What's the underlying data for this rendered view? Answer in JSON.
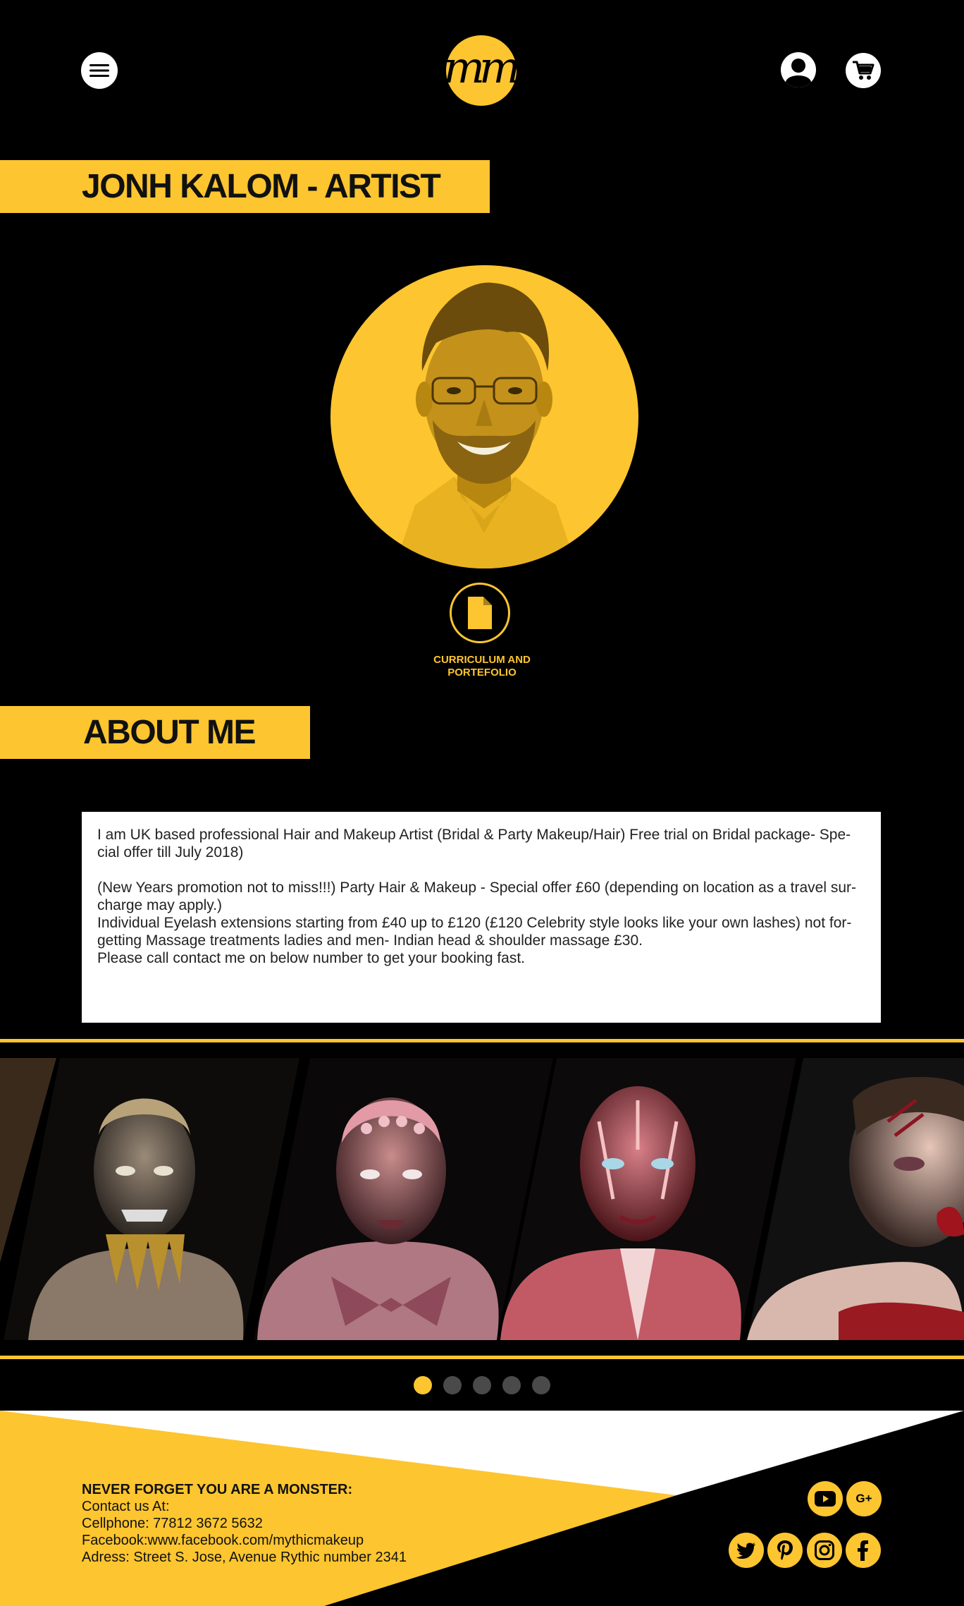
{
  "header": {
    "menu_icon": "hamburger-menu-icon",
    "logo_text": "mm",
    "account_icon": "user-account-icon",
    "cart_icon": "shopping-cart-icon"
  },
  "artist": {
    "title": "JONH KALOM - ARTIST",
    "photo": "artist-portrait",
    "cv_icon": "document-icon",
    "cv_label_line1": "CURRICULUM AND",
    "cv_label_line2": "PORTEFOLIO"
  },
  "about": {
    "title": "ABOUT ME",
    "paragraph1_line1": "I am UK based professional Hair and Makeup Artist (Bridal & Party Makeup/Hair) Free trial on Bridal package- Spe-",
    "paragraph1_line2": "cial offer till July 2018)",
    "paragraph2_line1": "(New Years promotion not to miss!!!) Party Hair & Makeup - Special offer £60 (depending on location as a travel sur-",
    "paragraph2_line2": "charge may apply.)",
    "paragraph2_line3": "Individual Eyelash extensions starting from £40 up to £120 (£120 Celebrity style looks like your own lashes) not for-",
    "paragraph2_line4": "getting Massage treatments ladies and men- Indian head & shoulder massage £30.",
    "paragraph2_line5": "Please call contact me on below number to get your booking fast."
  },
  "gallery": {
    "slides": [
      "creature-makeup-gold-horns",
      "lizard-scales-makeup",
      "muscle-anatomy-makeup",
      "wound-sfx-makeup"
    ],
    "dots_total": 5,
    "active_dot": 1
  },
  "footer": {
    "tagline": "NEVER FORGET YOU ARE A MONSTER:",
    "contact_heading": "Contact us At:",
    "cellphone": "Cellphone: 77812 3672 5632",
    "facebook": "Facebook:www.facebook.com/mythicmakeup",
    "address": "Adress: Street S. Jose, Avenue Rythic number 2341",
    "social_icons": [
      "youtube-icon",
      "google-plus-icon",
      "twitter-icon",
      "pinterest-icon",
      "instagram-icon",
      "facebook-icon"
    ],
    "gplus_label": "G+"
  },
  "colors": {
    "accent": "#fdc52f",
    "background": "#000000",
    "panel": "#ffffff"
  }
}
